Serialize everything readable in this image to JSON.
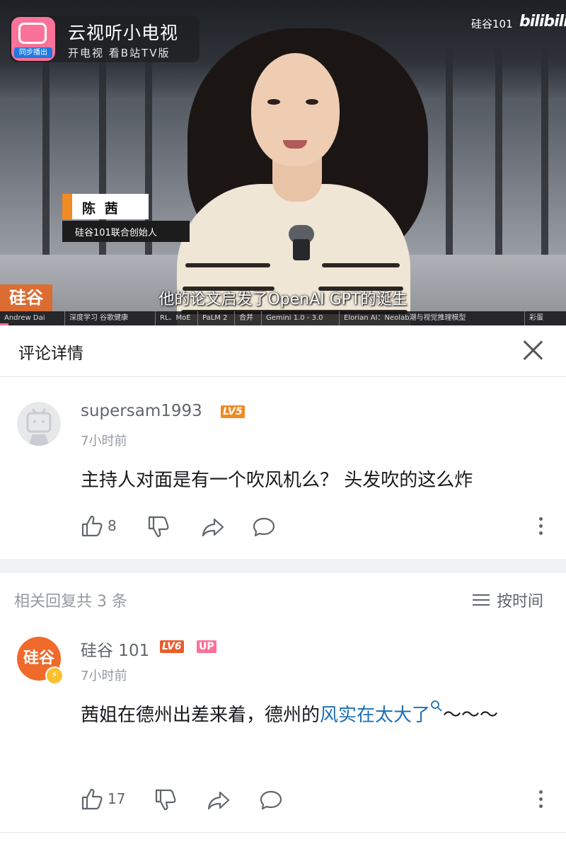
{
  "video": {
    "app_badge_title": "云视听小电视",
    "app_badge_subtitle": "开电视 看B站TV版",
    "app_icon_tag": "同步播出",
    "channel_watermark": "硅谷101",
    "platform_watermark": "bilibili",
    "lower_third_name": "陈 茜",
    "lower_third_title": "硅谷101联合创始人",
    "subtitle": "他的论文启发了OpenAI GPT的诞生",
    "logo_tile": "硅谷",
    "chapters": [
      "Andrew Dai",
      "深度学习 谷歌健康",
      "RL、MoE",
      "PaLM 2",
      "合并",
      "Gemini 1.0 - 3.0",
      "Elorian AI：Neolab潮与视觉推理模型",
      "彩蛋"
    ],
    "progress_fraction": 0.015
  },
  "detail": {
    "title": "评论详情",
    "close_icon": "close-icon"
  },
  "main_comment": {
    "username": "supersam1993",
    "level": "LV5",
    "time": "7小时前",
    "content": "主持人对面是有一个吹风机么？ 头发吹的这么炸",
    "likes": "8"
  },
  "replies": {
    "header": "相关回复共 3 条",
    "sort_label": "按时间",
    "items": [
      {
        "username": "硅谷 101",
        "level": "LV6",
        "badge": "UP",
        "avatar_text": "硅谷",
        "time": "7小时前",
        "content_before": "茜姐在德州出差来着，德州的",
        "content_link": "风实在太大了",
        "content_after": "～～～",
        "likes": "17"
      }
    ]
  },
  "colors": {
    "bilibili_pink": "#fb7299",
    "link_blue": "#1c6fb5",
    "level5_orange": "#f08a24",
    "level6_red": "#e85d2f",
    "up_badge_pink": "#fb7299"
  }
}
